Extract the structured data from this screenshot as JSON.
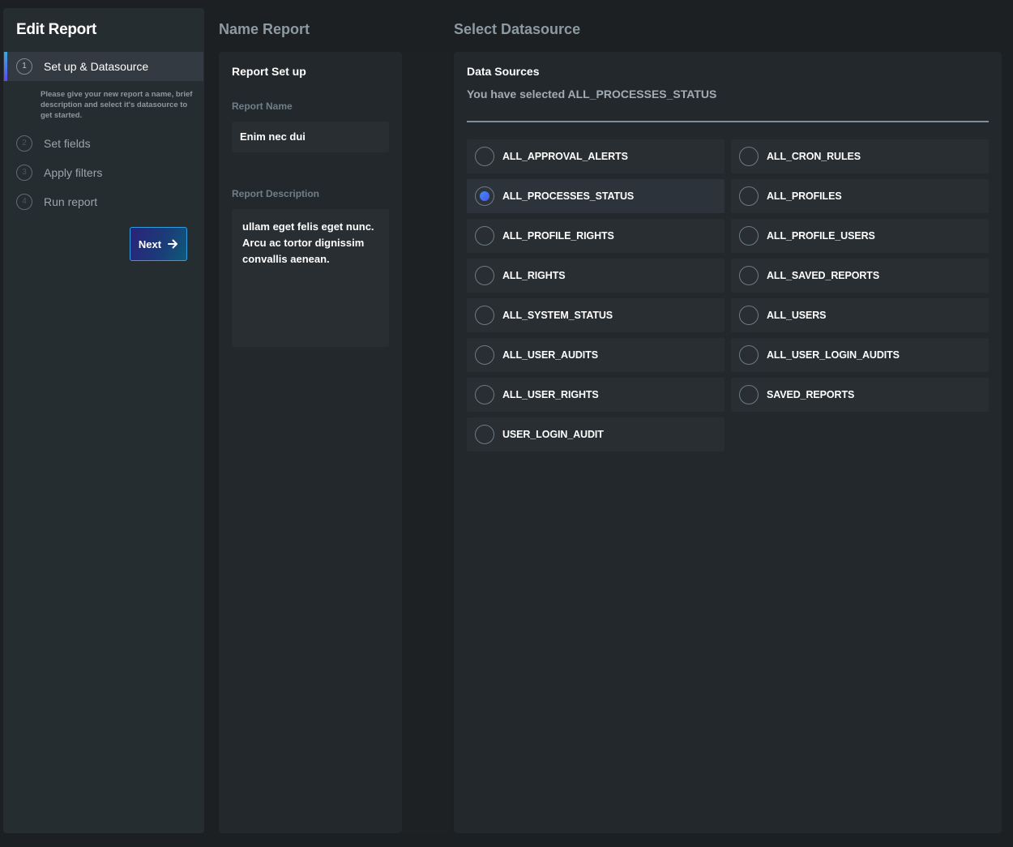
{
  "sidebar": {
    "title": "Edit Report",
    "steps": [
      {
        "number": "1",
        "label": "Set up & Datasource",
        "active": true
      },
      {
        "number": "2",
        "label": "Set fields",
        "active": false
      },
      {
        "number": "3",
        "label": "Apply filters",
        "active": false
      },
      {
        "number": "4",
        "label": "Run report",
        "active": false
      }
    ],
    "help_text": "Please give your new report a name, brief description and select it's datasource to get started.",
    "next_button": {
      "label": "Next",
      "icon": "arrow-right-icon"
    }
  },
  "name_report": {
    "heading": "Name Report",
    "panel_title": "Report Set up",
    "report_name_label": "Report Name",
    "report_name_value": "Enim nec dui",
    "report_description_label": "Report Description",
    "report_description_value": "ullam eget felis eget nunc. Arcu ac tortor dignissim convallis aenean."
  },
  "datasource": {
    "heading": "Select Datasource",
    "panel_title": "Data Sources",
    "selected_text": "You have selected ALL_PROCESSES_STATUS",
    "selected": "ALL_PROCESSES_STATUS",
    "items": [
      "ALL_APPROVAL_ALERTS",
      "ALL_CRON_RULES",
      "ALL_PROCESSES_STATUS",
      "ALL_PROFILES",
      "ALL_PROFILE_RIGHTS",
      "ALL_PROFILE_USERS",
      "ALL_RIGHTS",
      "ALL_SAVED_REPORTS",
      "ALL_SYSTEM_STATUS",
      "ALL_USERS",
      "ALL_USER_AUDITS",
      "ALL_USER_LOGIN_AUDITS",
      "ALL_USER_RIGHTS",
      "SAVED_REPORTS",
      "USER_LOGIN_AUDIT"
    ]
  },
  "colors": {
    "background": "#1d2023",
    "panel": "#23282c",
    "sidebar": "#262d31",
    "accent_blue": "#3f8ef5",
    "accent_purple": "#5a4cf0",
    "heading_muted": "#8d9aa2"
  }
}
